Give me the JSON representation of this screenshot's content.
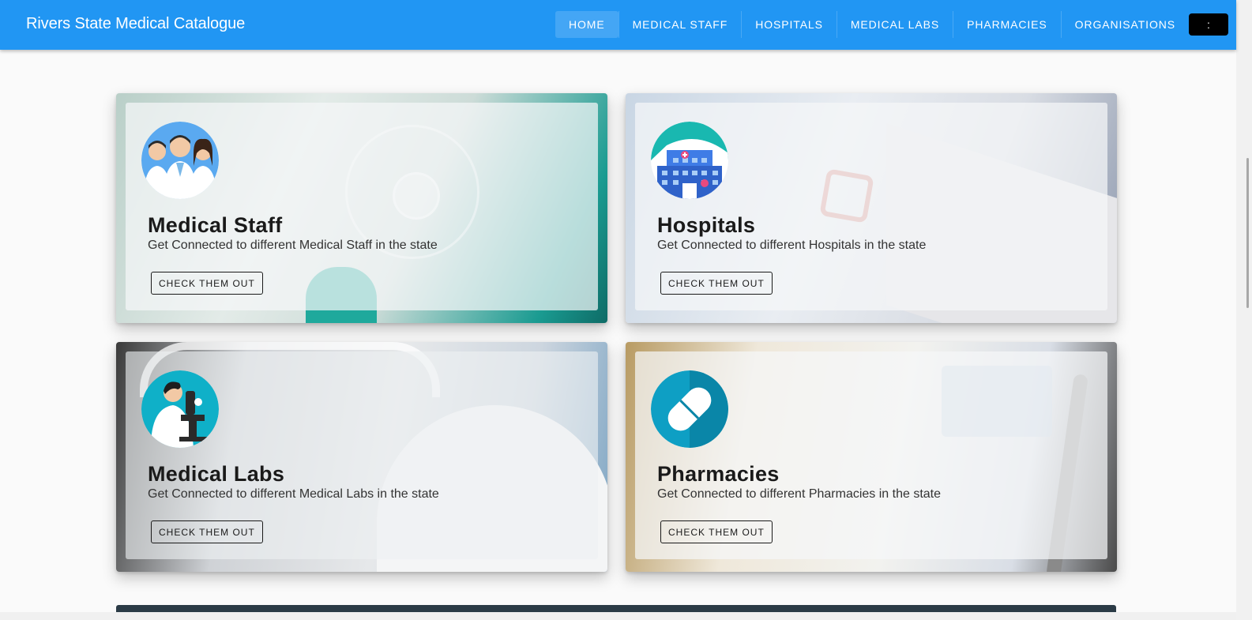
{
  "app": {
    "title": "Rivers State Medical Catalogue"
  },
  "nav": {
    "items": [
      "HOME",
      "MEDICAL STAFF",
      "HOSPITALS",
      "MEDICAL LABS",
      "PHARMACIES",
      "ORGANISATIONS"
    ],
    "active": "HOME",
    "more_label": ":"
  },
  "cards": [
    {
      "title": "Medical Staff",
      "description": "Get Connected to different Medical Staff in the state",
      "button": "CHECK THEM OUT",
      "icon": "medical-staff-icon"
    },
    {
      "title": "Hospitals",
      "description": "Get Connected to different Hospitals in the state",
      "button": "CHECK THEM OUT",
      "icon": "hospital-icon"
    },
    {
      "title": "Medical Labs",
      "description": "Get Connected to different Medical Labs in the state",
      "button": "CHECK THEM OUT",
      "icon": "lab-scientist-icon"
    },
    {
      "title": "Pharmacies",
      "description": "Get Connected to different Pharmacies in the state",
      "button": "CHECK THEM OUT",
      "icon": "pill-icon"
    }
  ],
  "colors": {
    "appbar": "#2196f3",
    "nav_more": "#000000"
  }
}
